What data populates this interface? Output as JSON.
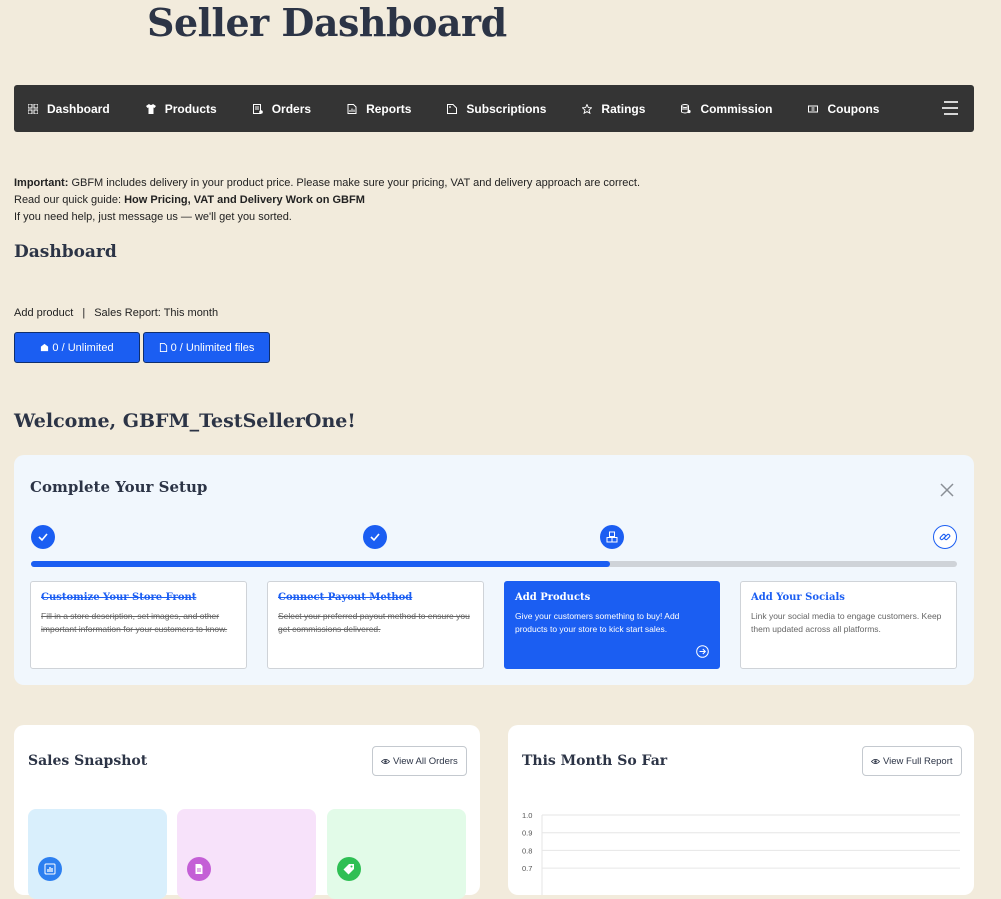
{
  "page": {
    "title": "Seller Dashboard"
  },
  "nav": {
    "items": [
      {
        "label": "Dashboard",
        "icon": "grid-icon"
      },
      {
        "label": "Products",
        "icon": "shirt-icon"
      },
      {
        "label": "Orders",
        "icon": "orders-icon"
      },
      {
        "label": "Reports",
        "icon": "report-icon"
      },
      {
        "label": "Subscriptions",
        "icon": "tag-icon"
      },
      {
        "label": "Ratings",
        "icon": "star-icon"
      },
      {
        "label": "Commission",
        "icon": "coins-icon"
      },
      {
        "label": "Coupons",
        "icon": "coupon-icon"
      }
    ],
    "menu_icon": "hamburger-icon"
  },
  "notice": {
    "line1_bold": "Important:",
    "line1_text": " GBFM includes delivery in your product price. Please make sure your pricing, VAT and delivery approach are correct.",
    "line2_text": "Read our quick guide: ",
    "line2_link": "How Pricing, VAT and Delivery Work on GBFM",
    "line3_text": "If you need help, just message us — we'll get you sorted."
  },
  "dashboard": {
    "heading": "Dashboard",
    "add_product": "Add product",
    "separator": "|",
    "sales_report": "Sales Report: This month",
    "quota_products": "0 / Unlimited",
    "quota_files": "0 / Unlimited files"
  },
  "welcome": "Welcome, GBFM_TestSellerOne!",
  "setup": {
    "title": "Complete Your Setup",
    "progress": 0.625,
    "steps": [
      {
        "title": "Customize Your Store Front",
        "desc": "Fill in a store description, set images, and other important information for your customers to know.",
        "state": "done"
      },
      {
        "title": "Connect Payout Method",
        "desc": "Select your preferred payout method to ensure you get commissions delivered.",
        "state": "done"
      },
      {
        "title": "Add Products",
        "desc": "Give your customers something to buy! Add products to your store to kick start sales.",
        "state": "active"
      },
      {
        "title": "Add Your Socials",
        "desc": "Link your social media to engage customers. Keep them updated across all platforms.",
        "state": "todo"
      }
    ]
  },
  "snapshot": {
    "title": "Sales Snapshot",
    "button": "View All Orders",
    "cards": [
      {
        "color": "#d9effc",
        "icon_bg": "#2c7ff0",
        "icon": "chart-icon"
      },
      {
        "color": "#f7e2fa",
        "icon_bg": "#c45fd6",
        "icon": "document-icon"
      },
      {
        "color": "#e2fbe8",
        "icon_bg": "#2fbf54",
        "icon": "tag-icon"
      }
    ]
  },
  "month": {
    "title": "This Month So Far",
    "button": "View Full Report"
  },
  "chart_data": {
    "type": "line",
    "title": "",
    "xlabel": "",
    "ylabel": "",
    "y_ticks": [
      "1.0",
      "0.9",
      "0.8",
      "0.7"
    ],
    "ylim": [
      0.7,
      1.0
    ],
    "grid": true,
    "series": []
  }
}
